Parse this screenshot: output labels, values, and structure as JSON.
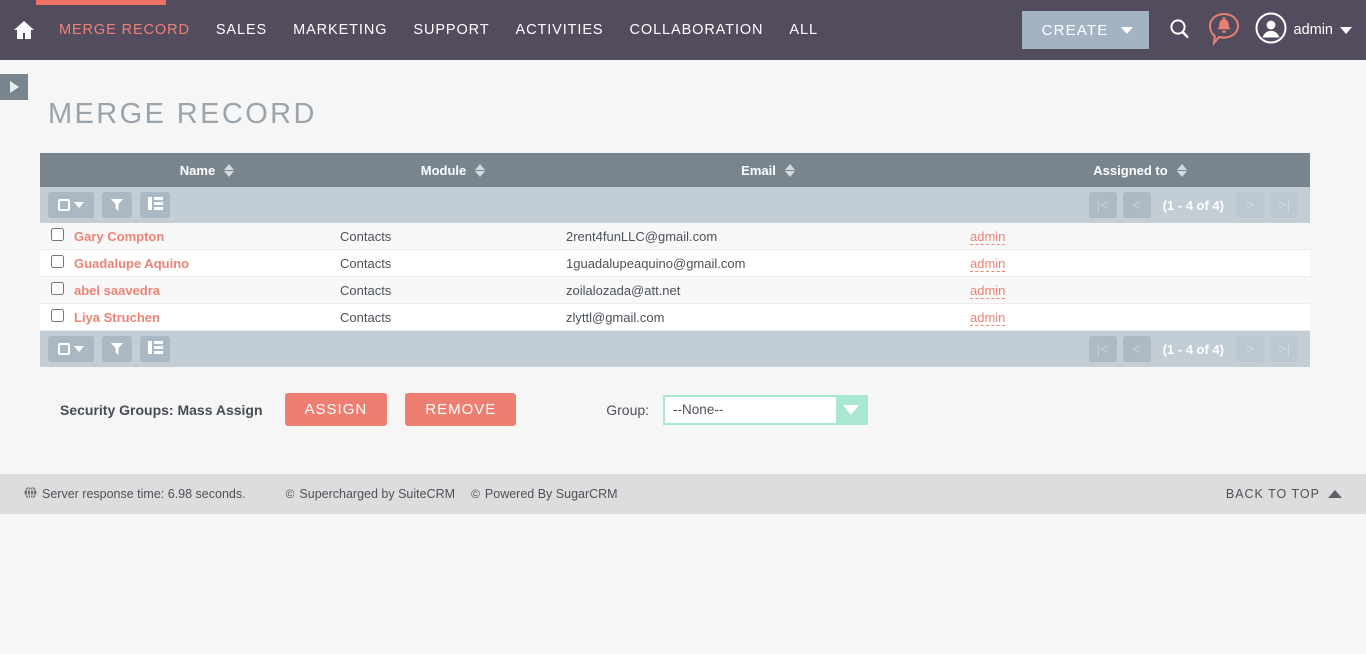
{
  "navbar": {
    "home_icon": "home-icon",
    "links": [
      {
        "label": "MERGE RECORD",
        "active": true
      },
      {
        "label": "SALES",
        "active": false
      },
      {
        "label": "MARKETING",
        "active": false
      },
      {
        "label": "SUPPORT",
        "active": false
      },
      {
        "label": "ACTIVITIES",
        "active": false
      },
      {
        "label": "COLLABORATION",
        "active": false
      },
      {
        "label": "ALL",
        "active": false
      }
    ],
    "create_label": "CREATE",
    "search_icon": "search-icon",
    "notification_icon": "notification-bell-icon",
    "avatar_icon": "user-avatar-icon",
    "user_name": "admin",
    "accent_color": "#ec7063",
    "background_color": "#534b5e"
  },
  "sidebar_toggle": {
    "icon": "chevron-right-icon"
  },
  "page": {
    "title": "MERGE RECORD"
  },
  "list": {
    "columns": [
      {
        "label": "Name",
        "sortable": true
      },
      {
        "label": "Module",
        "sortable": true
      },
      {
        "label": "Email",
        "sortable": true
      },
      {
        "label": "Assigned to",
        "sortable": true
      }
    ],
    "toolbar": {
      "select_all_icon": "checkbox-dropdown-icon",
      "filter_icon": "funnel-filter-icon",
      "columns_icon": "column-chooser-icon"
    },
    "pagination": {
      "first_label": "|<",
      "prev_label": "<",
      "count_label": "(1 - 4 of 4)",
      "next_label": ">",
      "last_label": ">|"
    },
    "rows": [
      {
        "selected": false,
        "name": "Gary Compton",
        "module": "Contacts",
        "email": "2rent4funLLC@gmail.com",
        "assigned_to": "admin"
      },
      {
        "selected": false,
        "name": "Guadalupe Aquino",
        "module": "Contacts",
        "email": "1guadalupeaquino@gmail.com",
        "assigned_to": "admin"
      },
      {
        "selected": false,
        "name": "abel saavedra",
        "module": "Contacts",
        "email": "zoilalozada@att.net",
        "assigned_to": "admin"
      },
      {
        "selected": false,
        "name": "Liya Struchen",
        "module": "Contacts",
        "email": "zlyttl@gmail.com",
        "assigned_to": "admin"
      }
    ]
  },
  "mass_assign": {
    "label": "Security Groups: Mass Assign",
    "assign_label": "ASSIGN",
    "remove_label": "REMOVE",
    "group_label": "Group:",
    "group_value": "--None--",
    "button_color": "#ec7f72",
    "select_border_color": "#a9e7d3"
  },
  "footer": {
    "globe_icon": "globe-icon",
    "response_time": "Server response time: 6.98 seconds.",
    "supercharged": "Supercharged by SuiteCRM",
    "powered_by": "Powered By SugarCRM",
    "copyright_glyph": "©",
    "back_to_top": "BACK TO TOP",
    "back_to_top_icon": "triangle-up-icon"
  }
}
